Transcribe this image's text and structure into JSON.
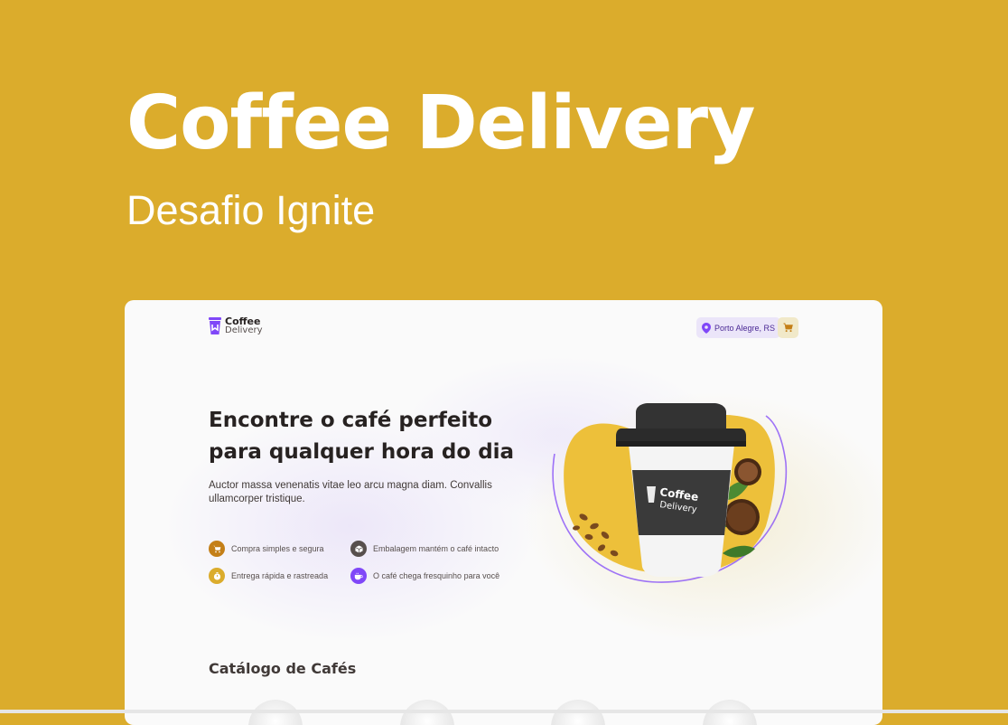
{
  "banner": {
    "title": "Coffee Delivery",
    "subtitle": "Desafio Ignite"
  },
  "app": {
    "logo": {
      "line1": "Coffee",
      "line2": "Delivery"
    },
    "location": "Porto Alegre, RS",
    "hero": {
      "headline_line1": "Encontre o café perfeito",
      "headline_line2": "para qualquer hora do dia",
      "intro": "Auctor massa venenatis vitae leo arcu magna diam. Convallis ullamcorper tristique.",
      "features": [
        {
          "label": "Compra simples e segura",
          "icon": "cart-icon",
          "color": "#C47F17"
        },
        {
          "label": "Embalagem mantém o café intacto",
          "icon": "package-icon",
          "color": "#574F4D"
        },
        {
          "label": "Entrega rápida e rastreada",
          "icon": "timer-icon",
          "color": "#DBAC2C"
        },
        {
          "label": "O café chega fresquinho para você",
          "icon": "coffee-icon",
          "color": "#8047F8"
        }
      ],
      "cup_label_line1": "Coffee",
      "cup_label_line2": "Delivery"
    },
    "catalog_title": "Catálogo de Cafés"
  },
  "colors": {
    "background": "#DBAC2C",
    "purple": "#8047F8",
    "purple_dark": "#4B2995",
    "yellow": "#DBAC2C",
    "yellow_dark": "#C47F17"
  }
}
